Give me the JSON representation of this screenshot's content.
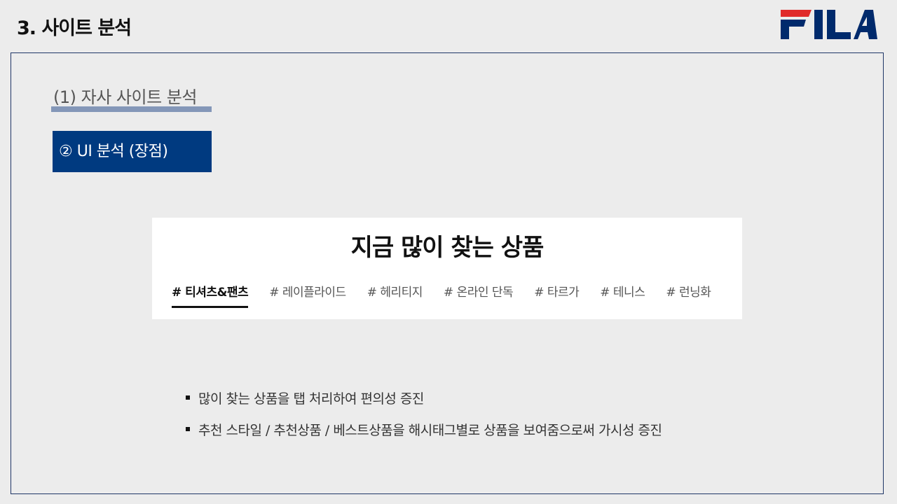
{
  "slide": {
    "title": "3. 사이트 분석"
  },
  "brand": {
    "logo_text": "FILA",
    "logo_red": "#e02b2b",
    "logo_navy": "#002a6c"
  },
  "section": {
    "heading": "(1) 자사 사이트 분석",
    "point_label": "② UI 분석 (장점)"
  },
  "capture": {
    "title": "지금 많이 찾는 상품",
    "tabs": [
      {
        "label": "# 티셔츠&팬츠",
        "active": true
      },
      {
        "label": "# 레이플라이드",
        "active": false
      },
      {
        "label": "# 헤리티지",
        "active": false
      },
      {
        "label": "# 온라인 단독",
        "active": false
      },
      {
        "label": "# 타르가",
        "active": false
      },
      {
        "label": "# 테니스",
        "active": false
      },
      {
        "label": "# 런닝화",
        "active": false
      }
    ]
  },
  "bullets": [
    "많이 찾는 상품을 탭 처리하여 편의성 증진",
    "추천 스타일 / 추천상품 / 베스트상품을 해시태그별로 상품을 보여줌으로써 가시성 증진"
  ],
  "colors": {
    "accent_navy": "#003a80",
    "underline": "#8497b8",
    "frame_border": "#1f3566"
  }
}
